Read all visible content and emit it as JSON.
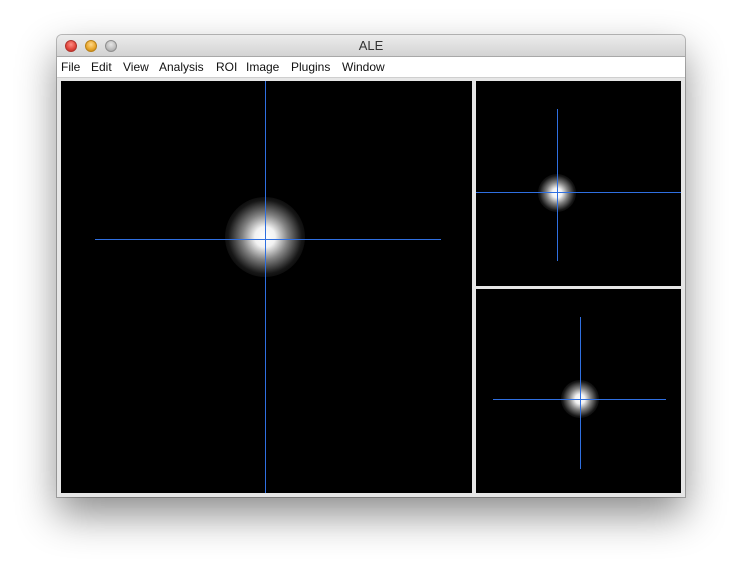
{
  "window": {
    "title": "ALE"
  },
  "menubar": {
    "items": [
      "File",
      "Edit",
      "View",
      "Analysis",
      "ROI",
      "Image",
      "Plugins",
      "Window"
    ]
  },
  "theme": {
    "crosshair_color": "#2f6fe0",
    "view_background": "#000000"
  }
}
